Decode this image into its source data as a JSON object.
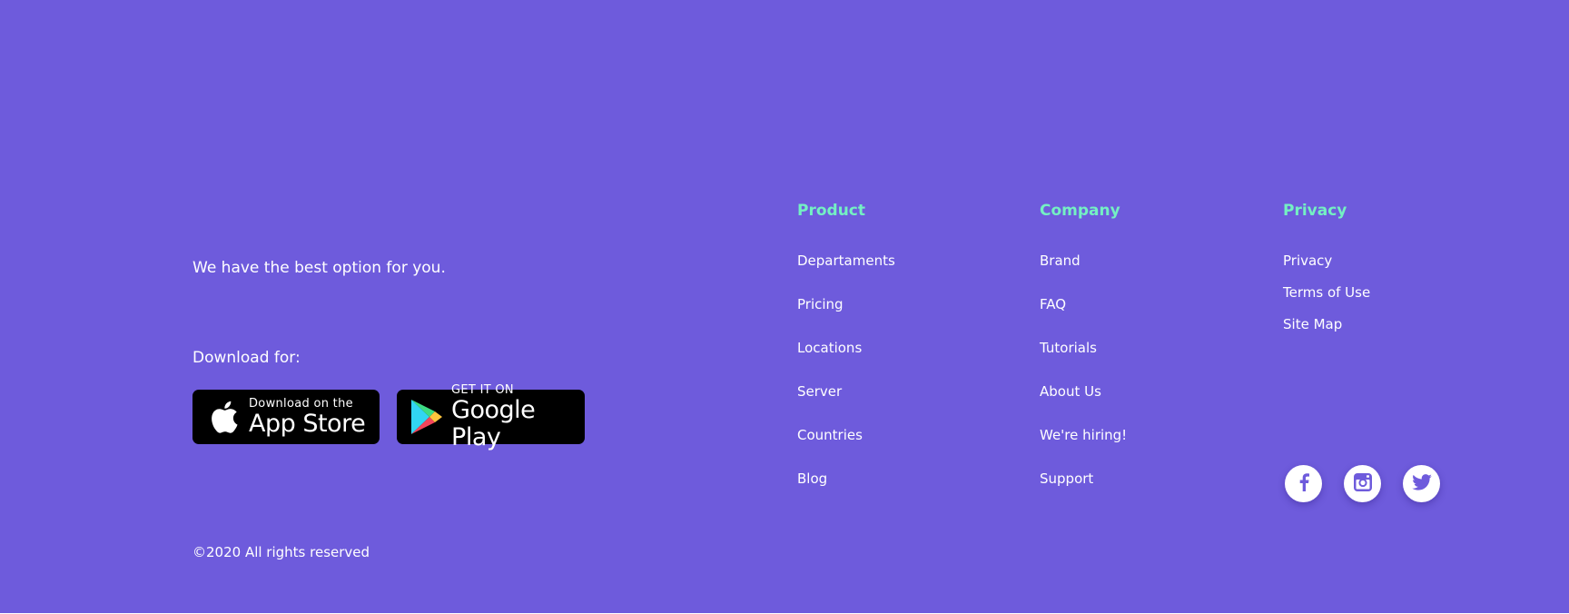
{
  "footer": {
    "tagline": "We have the best option for you.",
    "download_label": "Download for:",
    "app_store": {
      "small_text": "Download on the",
      "big_text": "App Store",
      "icon": "apple-icon"
    },
    "google_play": {
      "small_text": "GET IT ON",
      "big_text": "Google Play",
      "icon": "google-play-icon"
    },
    "columns": [
      {
        "title": "Product",
        "links": [
          "Departaments",
          "Pricing",
          "Locations",
          "Server",
          "Countries",
          "Blog"
        ]
      },
      {
        "title": "Company",
        "links": [
          "Brand",
          "FAQ",
          "Tutorials",
          "About Us",
          "We're hiring!",
          "Support"
        ]
      },
      {
        "title": "Privacy",
        "links": [
          "Privacy",
          "Terms of Use",
          "Site Map"
        ]
      }
    ],
    "social": [
      "facebook-icon",
      "instagram-icon",
      "twitter-icon"
    ],
    "copyright": "©2020 All rights reserved"
  },
  "colors": {
    "background": "#6e5bdc",
    "heading_accent": "#74f0c3",
    "text": "#ffffff",
    "store_button": "#000000",
    "social_icon": "#6e5bdc"
  }
}
